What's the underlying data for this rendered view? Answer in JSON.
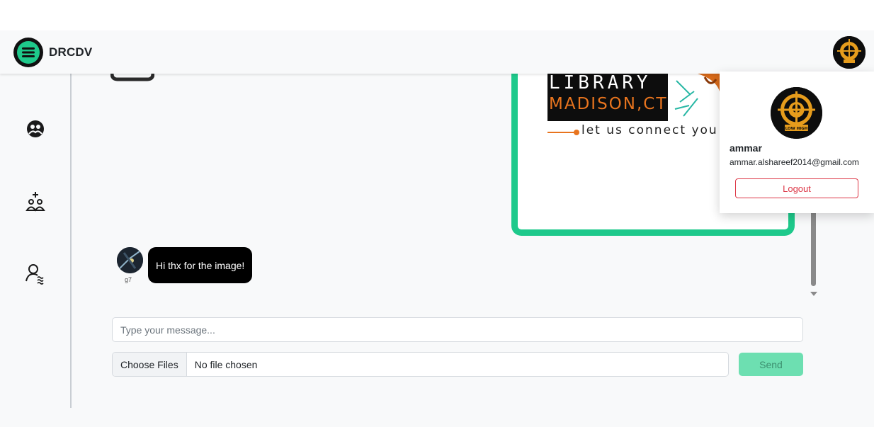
{
  "brand": {
    "name": "DRCDV",
    "logo_icon": "menu-lines-icon"
  },
  "colors": {
    "accent": "#1ec98b",
    "send_button": "#6ddfb1",
    "danger": "#dc3545",
    "bubble": "#000000"
  },
  "sidebar": {
    "items": [
      {
        "icon": "group-icon"
      },
      {
        "icon": "add-group-icon"
      },
      {
        "icon": "users-search-icon"
      }
    ]
  },
  "chat": {
    "messages": [
      {
        "type": "image",
        "caption_lines": [
          "LIBRARY",
          "MADISON,CT",
          "let us connect you"
        ]
      },
      {
        "type": "text",
        "user": "g7",
        "text": "Hi thx for the image!"
      }
    ]
  },
  "composer": {
    "placeholder": "Type your message...",
    "file_button": "Choose Files",
    "file_status": "No file chosen",
    "send_label": "Send"
  },
  "profile_menu": {
    "name": "ammar",
    "email": "ammar.alshareef2014@gmail.com",
    "logout_label": "Logout",
    "avatar_text": "LOW HIGH"
  }
}
